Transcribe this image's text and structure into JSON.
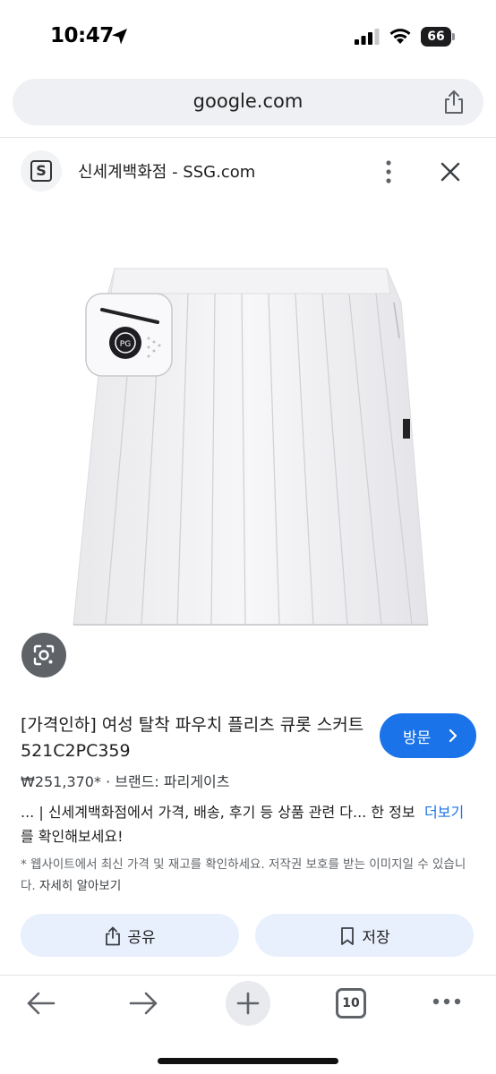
{
  "status_bar": {
    "time": "10:47",
    "battery": "66"
  },
  "browser": {
    "url": "google.com"
  },
  "site": {
    "favicon_letter": "S",
    "title": "신세계백화점 - SSG.com"
  },
  "product": {
    "title": "[가격인하] 여성 탈착 파우치 플리츠 큐롯 스커트 521C2PC359",
    "meta": "₩251,370* · 브랜드: 파리게이츠",
    "description": "... | 신세계백화점에서 가격, 배송, 후기 등 상품 관련 다... 한 정보를 확인해보세요!",
    "more_link": "더보기",
    "disclaimer": "* 웹사이트에서 최신 가격 및 재고를 확인하세요. 저작권 보호를 받는 이미지일 수 있습니다.",
    "learn_more": "자세히 알아보기",
    "visit_label": "방문",
    "image_alt": "white pleated skirt with detachable pouch"
  },
  "actions": {
    "share_label": "공유",
    "save_label": "저장"
  },
  "bottom_nav": {
    "tab_count": "10"
  },
  "icons": {
    "arrow": "location-arrow-icon",
    "signal": "cellular-signal-icon",
    "wifi": "wifi-icon",
    "share": "share-icon",
    "more": "more-vertical-icon",
    "close": "close-icon",
    "lens": "lens-icon",
    "chevron": "chevron-right-icon",
    "bookmark": "bookmark-icon",
    "back": "back-arrow-icon",
    "forward": "forward-arrow-icon",
    "plus": "plus-icon",
    "tabs": "tabs-icon",
    "more_horiz": "more-horizontal-icon"
  },
  "colors": {
    "accent": "#1a73e8",
    "chip_bg": "#e8f0fe",
    "url_bg": "#eef0f3"
  }
}
